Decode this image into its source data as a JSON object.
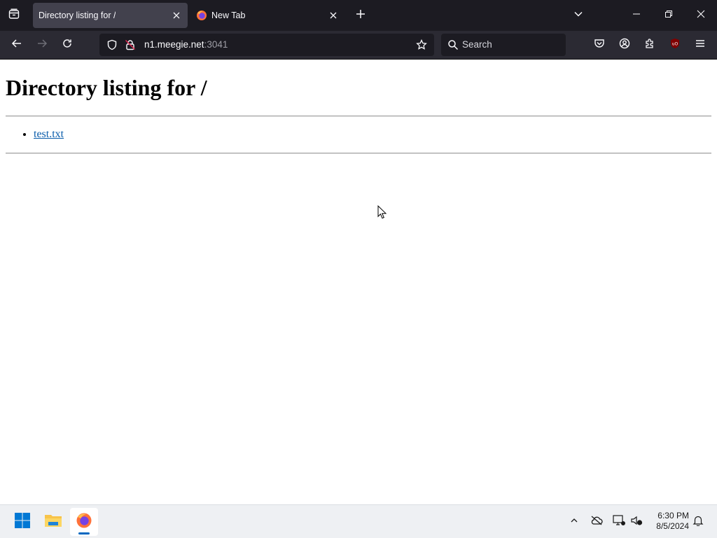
{
  "browser": {
    "tabs": [
      {
        "title": "Directory listing for /",
        "active": true
      },
      {
        "title": "New Tab",
        "active": false
      }
    ],
    "url": {
      "host": "n1.meegie.net",
      "port": ":3041"
    },
    "search_placeholder": "Search"
  },
  "page": {
    "heading": "Directory listing for /",
    "files": [
      {
        "name": "test.txt"
      }
    ]
  },
  "taskbar": {
    "time": "6:30 PM",
    "date": "8/5/2024"
  },
  "colors": {
    "tabbar_bg": "#1c1b22",
    "navbar_bg": "#2b2a33",
    "active_tab_bg": "#42414d",
    "link_color": "#0b5dab",
    "taskbar_bg": "#eef0f3",
    "accent": "#0067c0"
  }
}
